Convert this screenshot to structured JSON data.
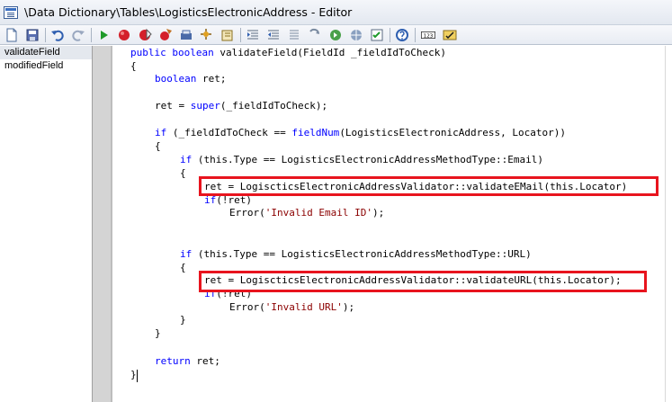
{
  "window": {
    "title": "\\Data Dictionary\\Tables\\LogisticsElectronicAddress - Editor"
  },
  "toolbar": {
    "icons": [
      "new-icon",
      "save-icon",
      "undo-icon",
      "redo-icon",
      "run-icon",
      "breakpoint-icon",
      "remove-breakpoints-icon",
      "enable-breakpoint-icon",
      "compile-icon",
      "lookup-icon",
      "scripts-icon",
      "indent-icon",
      "outdent-icon",
      "comment-icon",
      "uncomment-icon",
      "go-to-icon",
      "web-icon",
      "properties-icon",
      "help-icon",
      "line-numbers-icon",
      "spell-check-icon"
    ],
    "line_numbers_label": "123"
  },
  "sidebar": {
    "methods": [
      {
        "label": "validateField",
        "selected": true
      },
      {
        "label": "modifiedField",
        "selected": false
      }
    ]
  },
  "code": {
    "lines": [
      {
        "indent": 0,
        "parts": [
          [
            "kw",
            "public boolean"
          ],
          [
            "t",
            " validateField(FieldId _fieldIdToCheck)"
          ]
        ]
      },
      {
        "indent": 0,
        "parts": [
          [
            "t",
            "{"
          ]
        ]
      },
      {
        "indent": 1,
        "parts": [
          [
            "kw",
            "boolean"
          ],
          [
            "t",
            " ret;"
          ]
        ]
      },
      {
        "indent": 0,
        "parts": []
      },
      {
        "indent": 1,
        "parts": [
          [
            "t",
            "ret = "
          ],
          [
            "kw",
            "super"
          ],
          [
            "t",
            "(_fieldIdToCheck);"
          ]
        ]
      },
      {
        "indent": 0,
        "parts": []
      },
      {
        "indent": 1,
        "parts": [
          [
            "kw",
            "if"
          ],
          [
            "t",
            " (_fieldIdToCheck == "
          ],
          [
            "kw",
            "fieldNum"
          ],
          [
            "t",
            "(LogisticsElectronicAddress, Locator))"
          ]
        ]
      },
      {
        "indent": 1,
        "parts": [
          [
            "t",
            "{"
          ]
        ]
      },
      {
        "indent": 2,
        "parts": [
          [
            "kw",
            "if"
          ],
          [
            "t",
            " (this.Type == LogisticsElectronicAddressMethodType::Email)"
          ]
        ]
      },
      {
        "indent": 2,
        "parts": [
          [
            "t",
            "{"
          ]
        ]
      },
      {
        "indent": 3,
        "parts": [
          [
            "t",
            "ret = LogiscticsElectronicAddressValidator::validateEMail(this.Locator)"
          ]
        ]
      },
      {
        "indent": 3,
        "parts": [
          [
            "kw",
            "if"
          ],
          [
            "t",
            "(!ret)"
          ]
        ]
      },
      {
        "indent": 4,
        "parts": [
          [
            "t",
            "Error("
          ],
          [
            "str",
            "'Invalid Email ID'"
          ],
          [
            "t",
            ");"
          ]
        ]
      },
      {
        "indent": 0,
        "parts": []
      },
      {
        "indent": 2,
        "parts": [
          [
            "kw",
            "if"
          ],
          [
            "t",
            " (this.Type == LogisticsElectronicAddressMethodType::URL)"
          ]
        ]
      },
      {
        "indent": 2,
        "parts": [
          [
            "t",
            "{"
          ]
        ]
      },
      {
        "indent": 3,
        "parts": [
          [
            "t",
            "ret = LogiscticsElectronicAddressValidator::validateURL(this.Locator);"
          ]
        ]
      },
      {
        "indent": 3,
        "parts": [
          [
            "kw",
            "if"
          ],
          [
            "t",
            "(!ret)"
          ]
        ]
      },
      {
        "indent": 4,
        "parts": [
          [
            "t",
            "Error("
          ],
          [
            "str",
            "'Invalid URL'"
          ],
          [
            "t",
            ");"
          ]
        ]
      },
      {
        "indent": 2,
        "parts": [
          [
            "t",
            "}"
          ]
        ]
      },
      {
        "indent": 1,
        "parts": [
          [
            "t",
            "}"
          ]
        ]
      },
      {
        "indent": 0,
        "parts": []
      },
      {
        "indent": 1,
        "parts": [
          [
            "kw",
            "return"
          ],
          [
            "t",
            " ret;"
          ]
        ]
      },
      {
        "indent": 0,
        "parts": [
          [
            "t",
            "}"
          ]
        ]
      }
    ]
  },
  "colors": {
    "keyword": "#0000ff",
    "string": "#8b0000",
    "highlight_box": "#e8141e"
  }
}
